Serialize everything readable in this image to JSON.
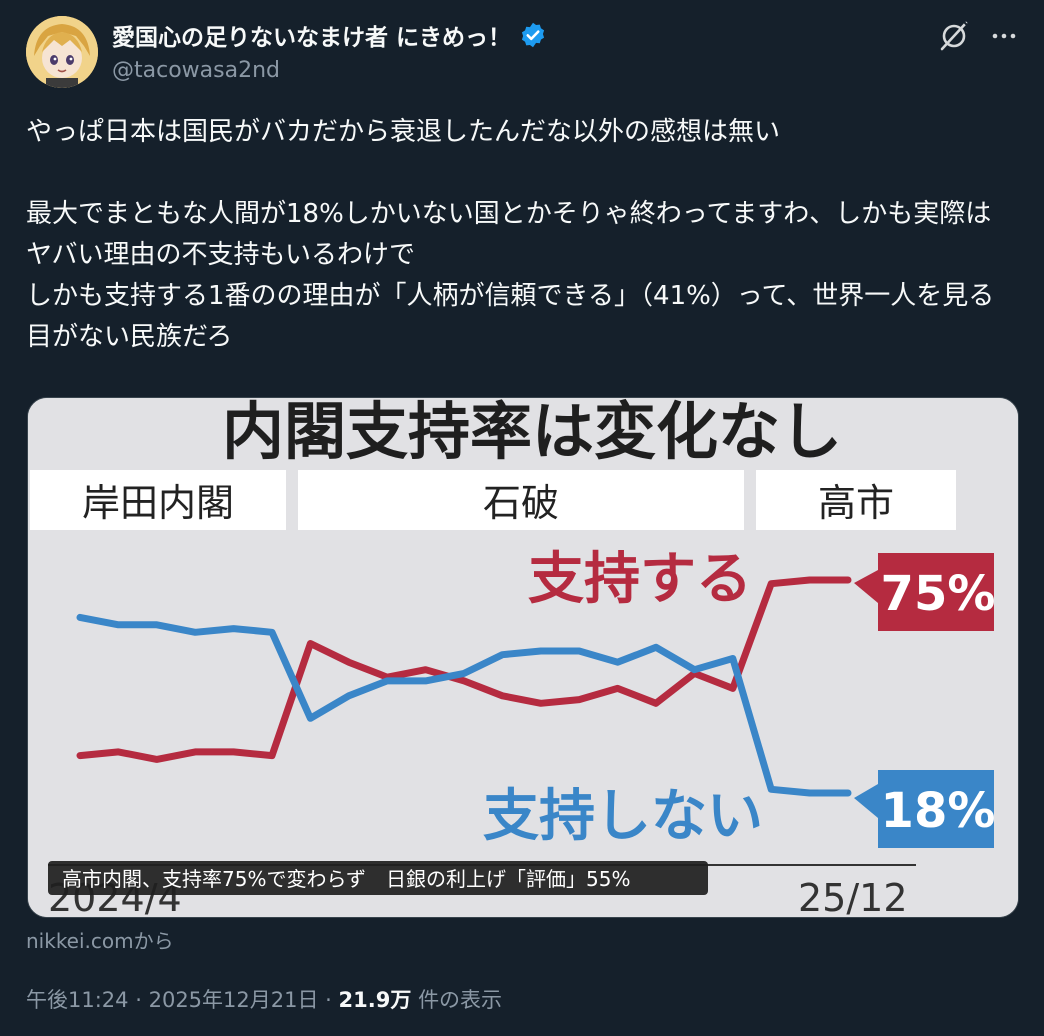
{
  "author": {
    "display_name": "愛国心の足りないなまけ者 にきめっ！",
    "handle": "@tacowasa2nd",
    "verified": true,
    "avatar_icon": "anime-avatar"
  },
  "icons": {
    "grok": "grok-icon",
    "more": "more-options-icon",
    "verified": "verified-badge-icon"
  },
  "tweet": {
    "text": "やっぱ日本は国民がバカだから衰退したんだな以外の感想は無い\n\n最大でまともな人間が18%しかいない国とかそりゃ終わってますわ、しかも実際はヤバい理由の不支持もいるわけで\nしかも支持する1番のの理由が「人柄が信頼できる」（41%）って、世界一人を見る目がない民族だろ"
  },
  "media": {
    "title": "内閣支持率は変化なし",
    "cabinets": [
      "岸田内閣",
      "石破",
      "高市"
    ],
    "caption": "高市内閣、支持率75%で変わらず　日銀の利上げ「評価」55%",
    "x_start_label": "2024/4",
    "x_end_label": "25/12",
    "colors": {
      "support": "#b52b40",
      "oppose": "#3a86c8"
    },
    "chart_data": {
      "type": "line",
      "series": [
        {
          "name": "支持する",
          "end_label": "75%",
          "values": [
            28,
            29,
            27,
            29,
            29,
            28,
            58,
            53,
            49,
            51,
            48,
            44,
            42,
            43,
            46,
            42,
            50,
            46,
            74,
            75,
            75
          ]
        },
        {
          "name": "支持しない",
          "end_label": "18%",
          "values": [
            65,
            63,
            63,
            61,
            62,
            61,
            38,
            44,
            48,
            48,
            50,
            55,
            56,
            56,
            53,
            57,
            51,
            54,
            19,
            18,
            18
          ]
        }
      ]
    }
  },
  "source": "nikkei.comから",
  "meta": {
    "time": "午後11:24",
    "date": "2025年12月21日",
    "separator": "·",
    "views_count": "21.9万",
    "views_label": "件の表示"
  }
}
